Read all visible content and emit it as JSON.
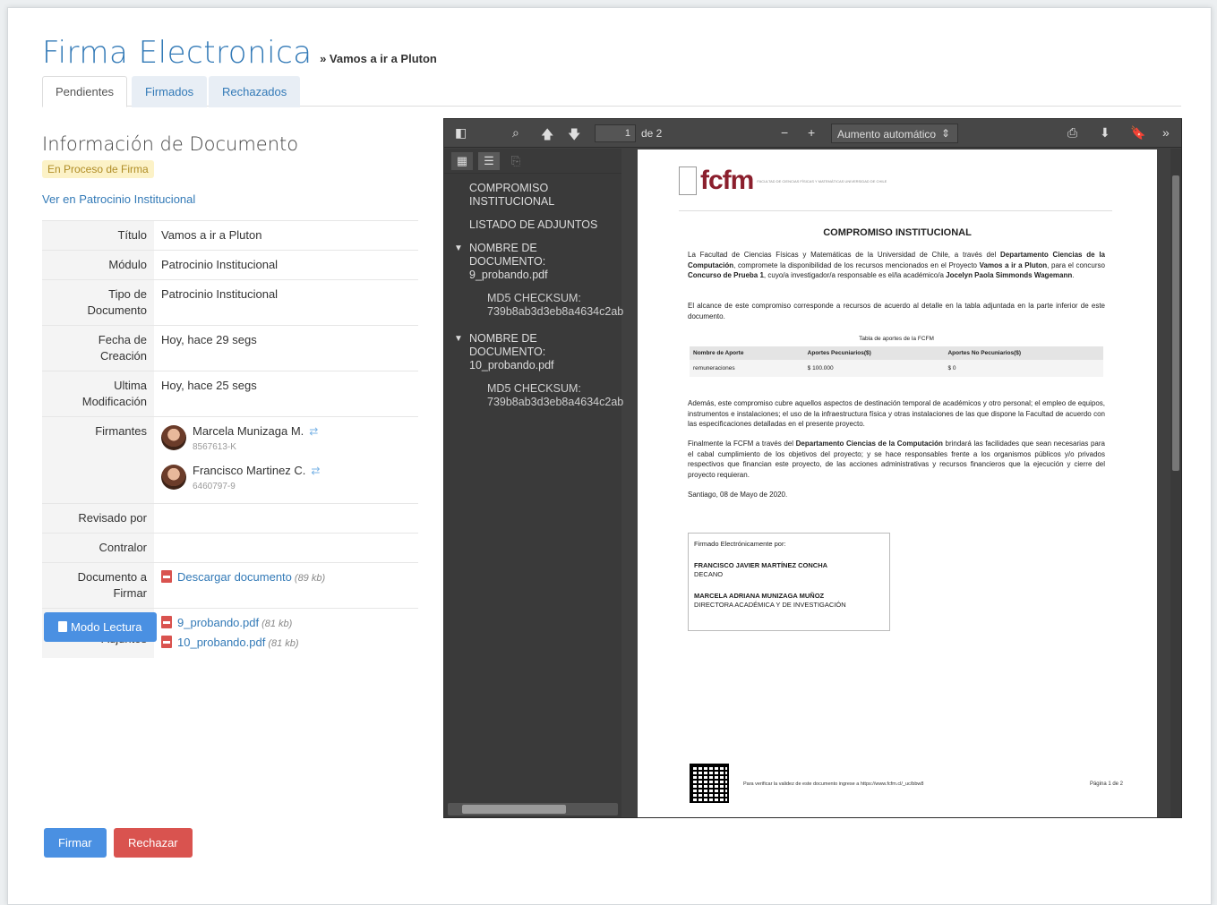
{
  "header": {
    "title": "Firma Electronica",
    "separator": "»",
    "subtitle": "Vamos a ir a Pluton"
  },
  "tabs": [
    {
      "label": "Pendientes",
      "active": true
    },
    {
      "label": "Firmados",
      "active": false
    },
    {
      "label": "Rechazados",
      "active": false
    }
  ],
  "info": {
    "title": "Información de Documento",
    "status": "En Proceso de Firma",
    "link": "Ver en Patrocinio Institucional"
  },
  "details": {
    "titulo": {
      "label": "Título",
      "value": "Vamos a ir a Pluton"
    },
    "modulo": {
      "label": "Módulo",
      "value": "Patrocinio Institucional"
    },
    "tipo": {
      "label": "Tipo de Documento",
      "value": "Patrocinio Institucional"
    },
    "fecha": {
      "label": "Fecha de Creación",
      "value": "Hoy, hace 29 segs"
    },
    "ultima": {
      "label": "Ultima Modificación",
      "value": "Hoy, hace 25 segs"
    },
    "firmantes": {
      "label": "Firmantes",
      "items": [
        {
          "name": "Marcela Munizaga M.",
          "id": "8567613-K"
        },
        {
          "name": "Francisco Martinez C.",
          "id": "6460797-9"
        }
      ]
    },
    "revisado": {
      "label": "Revisado por",
      "value": ""
    },
    "contralor": {
      "label": "Contralor",
      "value": ""
    },
    "documento": {
      "label": "Documento a Firmar",
      "link": "Descargar documento",
      "size": "(89 kb)"
    },
    "adjuntos": {
      "label": "Documentos Adjuntos",
      "items": [
        {
          "name": "9_probando.pdf",
          "size": "(81 kb)"
        },
        {
          "name": "10_probando.pdf",
          "size": "(81 kb)"
        }
      ]
    }
  },
  "buttons": {
    "lectura": "Modo Lectura",
    "firmar": "Firmar",
    "rechazar": "Rechazar"
  },
  "viewer": {
    "page_number": "1",
    "page_of": "de 2",
    "zoom": "Aumento automático",
    "outline": [
      {
        "text": "COMPROMISO INSTITUCIONAL"
      },
      {
        "text": "LISTADO DE ADJUNTOS"
      },
      {
        "text": "NOMBRE DE DOCUMENTO: 9_probando.pdf"
      },
      {
        "text": "MD5 CHECKSUM: 739b8ab3d3eb8a4634c2ab"
      },
      {
        "text": "NOMBRE DE DOCUMENTO: 10_probando.pdf"
      },
      {
        "text": "MD5 CHECKSUM: 739b8ab3d3eb8a4634c2ab"
      }
    ],
    "doc": {
      "logo_text": "fcfm",
      "faculty": "FACULTAD DE CIENCIAS FÍSICAS Y MATEMÁTICAS UNIVERSIDAD DE CHILE",
      "title": "COMPROMISO INSTITUCIONAL",
      "p1_a": "La Facultad de Ciencias Físicas y Matemáticas de la Universidad de Chile, a través del ",
      "p1_b": "Departamento Ciencias de la Computación",
      "p1_c": ", compromete la disponibilidad de los recursos mencionados en el Proyecto ",
      "p1_d": "Vamos a ir a Pluton",
      "p1_e": ", para el concurso ",
      "p1_f": "Concurso de Prueba 1",
      "p1_g": ", cuyo/a investigador/a responsable es el/la académico/a ",
      "p1_h": "Jocelyn Paola Simmonds Wagemann",
      "p1_i": ".",
      "p2": "El alcance de este compromiso corresponde a recursos de acuerdo al detalle en la tabla adjuntada en la parte inferior de este documento.",
      "table_caption": "Tabla de aportes de la FCFM",
      "table_headers": [
        "Nombre de Aporte",
        "Aportes Pecuniarios($)",
        "Aportes No Pecuniarios($)"
      ],
      "table_row": [
        "remuneraciones",
        "$ 100.000",
        "$ 0"
      ],
      "p3": "Además, este compromiso cubre aquellos aspectos de destinación temporal de académicos y otro personal; el empleo de equipos, instrumentos e instalaciones; el uso de la infraestructura física y otras instalaciones de las que dispone la Facultad de acuerdo con las especificaciones detalladas en el presente proyecto.",
      "p4_a": "Finalmente la FCFM a través del ",
      "p4_b": "Departamento Ciencias de la Computación",
      "p4_c": " brindará las facilidades que sean necesarias para el cabal cumplimiento de los objetivos del proyecto; y se hace responsables frente a los organismos públicos y/o privados respectivos que financian este proyecto, de las acciones administrativas y recursos financieros que la ejecución y cierre del proyecto requieran.",
      "date_line": "Santiago, 08 de Mayo de 2020.",
      "sign_heading": "Firmado Electrónicamente por:",
      "signer1_name": "FRANCISCO JAVIER MARTÍNEZ CONCHA",
      "signer1_role": "DECANO",
      "signer2_name": "MARCELA ADRIANA MUNIZAGA MUÑOZ",
      "signer2_role": "DIRECTORA ACADÉMICA Y DE INVESTIGACIÓN",
      "footer_verify": "Para verificar la validez de este documento ingrese a https://www.fcfm.cl/_uc/bbw8",
      "footer_page": "Página 1 de 2"
    }
  },
  "colors": {
    "primary": "#4a90e2",
    "danger": "#d9534f",
    "link": "#337ab7",
    "status_bg": "#fcf2c7",
    "fcfm": "#8b1f2d"
  },
  "icons": [
    "sidebar-toggle-icon",
    "search-icon",
    "arrow-up-icon",
    "arrow-down-icon",
    "zoom-out-icon",
    "zoom-in-icon",
    "print-icon",
    "download-icon",
    "bookmark-icon",
    "chevron-double-right-icon",
    "thumbnails-icon",
    "outline-icon",
    "attachment-icon",
    "pdf-file-icon",
    "equals-icon",
    "book-icon"
  ]
}
